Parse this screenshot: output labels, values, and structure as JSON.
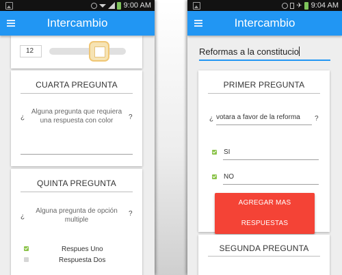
{
  "left": {
    "status": {
      "time": "9:00 AM"
    },
    "app_title": "Intercambio",
    "slider": {
      "value_text": "12"
    },
    "card4": {
      "title": "CUARTA PREGUNTA",
      "q_open": "¿",
      "q_text": "Alguna pregunta que requiera una respuesta con color",
      "q_close": "?"
    },
    "card5": {
      "title": "QUINTA PREGUNTA",
      "q_open": "¿",
      "q_text": "Alguna pregunta de opción multiple",
      "q_close": "?",
      "options": [
        {
          "label": "Respues Uno",
          "checked": true
        },
        {
          "label": "Respuesta Dos",
          "checked": false
        }
      ]
    }
  },
  "right": {
    "status": {
      "time": "9:04 AM"
    },
    "app_title": "Intercambio",
    "topic_input": "Reformas a la constitucio",
    "card1": {
      "title": "PRIMER PREGUNTA",
      "q_open": "¿",
      "q_value": "votara a favor de la reforma",
      "q_close": "?",
      "options": [
        {
          "label": "SI",
          "checked": true
        },
        {
          "label": "NO",
          "checked": true
        }
      ],
      "add_button": "AGREGAR MAS RESPUESTAS"
    },
    "card2": {
      "title": "SEGUNDA PREGUNTA"
    }
  },
  "colors": {
    "app_bar": "#2196f3",
    "accent_red": "#f44336",
    "check_green": "#8bc34a"
  }
}
